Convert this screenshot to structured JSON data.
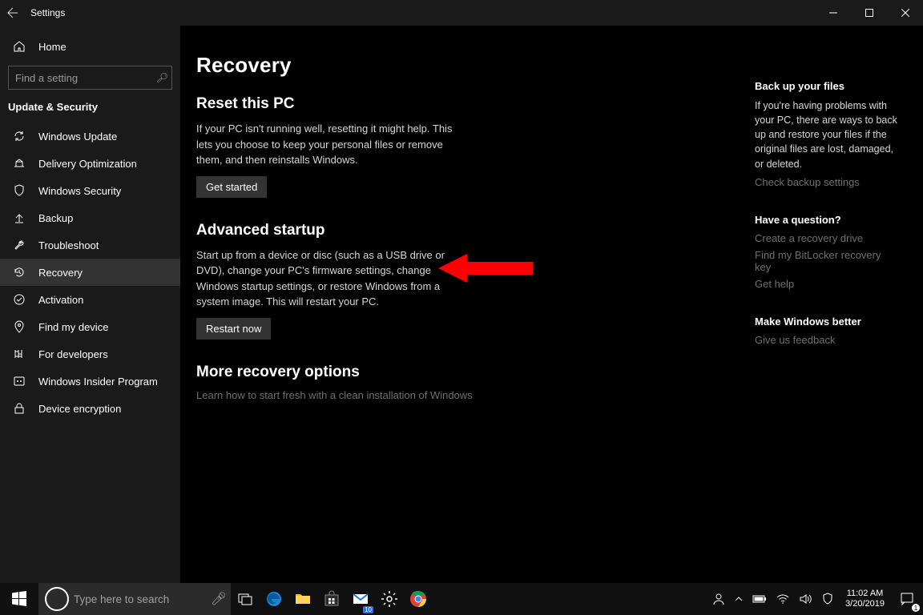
{
  "titlebar": {
    "title": "Settings"
  },
  "sidebar": {
    "home": "Home",
    "search_placeholder": "Find a setting",
    "section": "Update & Security",
    "items": [
      {
        "label": "Windows Update"
      },
      {
        "label": "Delivery Optimization"
      },
      {
        "label": "Windows Security"
      },
      {
        "label": "Backup"
      },
      {
        "label": "Troubleshoot"
      },
      {
        "label": "Recovery"
      },
      {
        "label": "Activation"
      },
      {
        "label": "Find my device"
      },
      {
        "label": "For developers"
      },
      {
        "label": "Windows Insider Program"
      },
      {
        "label": "Device encryption"
      }
    ]
  },
  "main": {
    "title": "Recovery",
    "reset": {
      "heading": "Reset this PC",
      "text": "If your PC isn't running well, resetting it might help. This lets you choose to keep your personal files or remove them, and then reinstalls Windows.",
      "button": "Get started"
    },
    "advanced": {
      "heading": "Advanced startup",
      "text": "Start up from a device or disc (such as a USB drive or DVD), change your PC's firmware settings, change Windows startup settings, or restore Windows from a system image. This will restart your PC.",
      "button": "Restart now"
    },
    "more": {
      "heading": "More recovery options",
      "link": "Learn how to start fresh with a clean installation of Windows"
    }
  },
  "right": {
    "backup": {
      "heading": "Back up your files",
      "text": "If you're having problems with your PC, there are ways to back up and restore your files if the original files are lost, damaged, or deleted.",
      "link": "Check backup settings"
    },
    "question": {
      "heading": "Have a question?",
      "links": [
        "Create a recovery drive",
        "Find my BitLocker recovery key",
        "Get help"
      ]
    },
    "better": {
      "heading": "Make Windows better",
      "link": "Give us feedback"
    }
  },
  "taskbar": {
    "search_placeholder": "Type here to search",
    "mail_badge": "10",
    "time": "11:02 AM",
    "date": "3/20/2019",
    "notif_badge": "1"
  }
}
